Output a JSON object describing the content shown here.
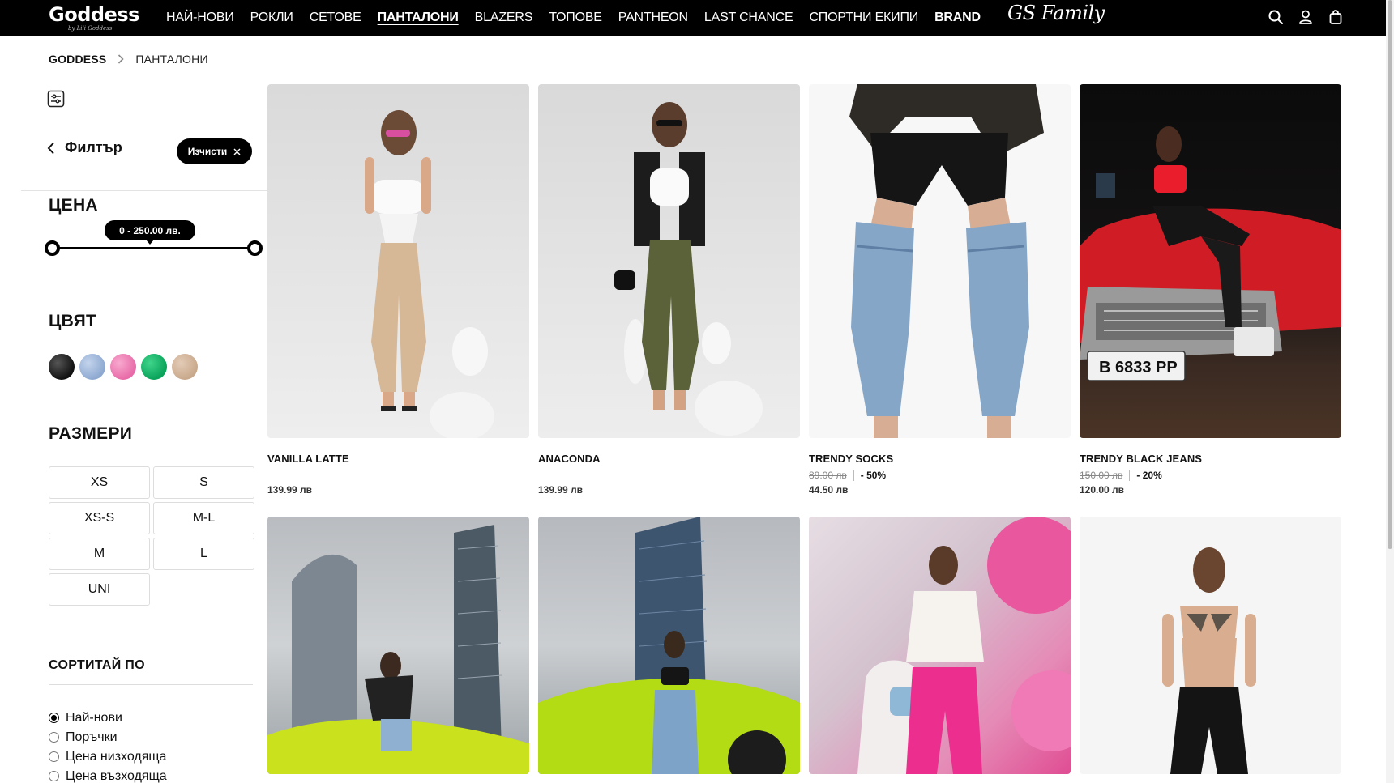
{
  "brand": {
    "logo_text": "Goddess",
    "logo_subtitle": "by Lili Goddess",
    "family_logo": "GS Family"
  },
  "nav": {
    "items": [
      {
        "label": "НАЙ-НОВИ"
      },
      {
        "label": "РОКЛИ"
      },
      {
        "label": "СЕТОВЕ"
      },
      {
        "label": "ПАНТАЛОНИ"
      },
      {
        "label": "BLAZERS"
      },
      {
        "label": "ТОПОВЕ"
      },
      {
        "label": "PANTHEON"
      },
      {
        "label": "LAST CHANCE"
      },
      {
        "label": "СПОРТНИ ЕКИПИ"
      },
      {
        "label": "BRAND"
      }
    ],
    "active_index": 3
  },
  "breadcrumb": {
    "home": "GODDESS",
    "current": "ПАНТАЛОНИ"
  },
  "filter": {
    "title": "Филтър",
    "clear_label": "Изчисти",
    "price_title": "ЦЕНА",
    "price_range": "0 - 250.00 лв.",
    "price_min": 0,
    "price_max": 250,
    "color_title": "ЦВЯТ",
    "colors": [
      {
        "name": "black",
        "hex": "#2a2a2a"
      },
      {
        "name": "light-blue",
        "hex": "#9bb4d8"
      },
      {
        "name": "pink",
        "hex": "#ee82b6"
      },
      {
        "name": "green",
        "hex": "#16b86a"
      },
      {
        "name": "beige",
        "hex": "#d2b49a"
      }
    ],
    "size_title": "РАЗМЕРИ",
    "sizes": [
      "XS",
      "S",
      "XS-S",
      "M-L",
      "M",
      "L",
      "UNI"
    ],
    "sort_title": "СОРТИТАЙ ПО",
    "sort_options": [
      {
        "label": "Най-нови",
        "selected": true
      },
      {
        "label": "Поръчки",
        "selected": false
      },
      {
        "label": "Цена низходяща",
        "selected": false
      },
      {
        "label": "Цена възходяща",
        "selected": false
      }
    ]
  },
  "products": [
    {
      "name": "VANILLA LATTE",
      "old_price": "",
      "discount": "",
      "price": "139.99 лв"
    },
    {
      "name": "ANACONDA",
      "old_price": "",
      "discount": "",
      "price": "139.99 лв"
    },
    {
      "name": "TRENDY SOCKS",
      "old_price": "89.00 лв",
      "discount": "- 50%",
      "price": "44.50 лв"
    },
    {
      "name": "TRENDY BLACK JEANS",
      "old_price": "150.00 лв",
      "discount": "- 20%",
      "price": "120.00 лв"
    },
    {
      "name": "",
      "old_price": "",
      "discount": "",
      "price": ""
    },
    {
      "name": "",
      "old_price": "",
      "discount": "",
      "price": ""
    },
    {
      "name": "",
      "old_price": "",
      "discount": "",
      "price": ""
    },
    {
      "name": "",
      "old_price": "",
      "discount": "",
      "price": ""
    }
  ],
  "license_plate": "B 6833 PP",
  "colors": {
    "topbar": "#000000",
    "accent": "#000000",
    "text": "#111111"
  }
}
